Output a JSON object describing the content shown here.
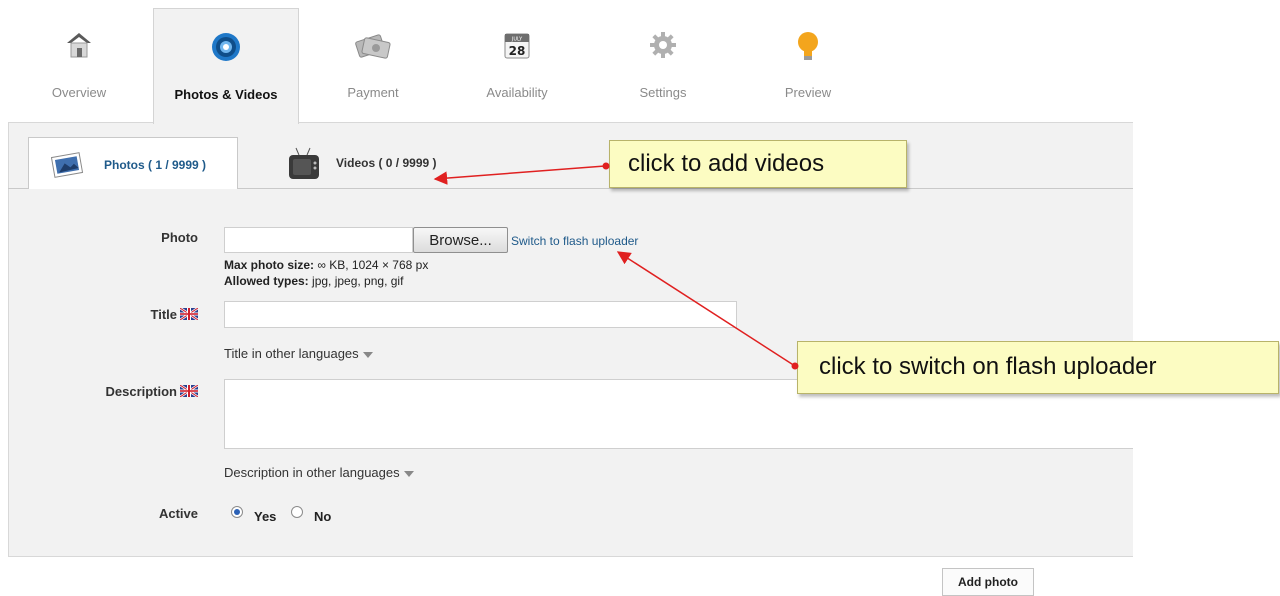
{
  "top_tabs": [
    {
      "label": "Overview",
      "icon": "house-icon",
      "active": false
    },
    {
      "label": "Photos & Videos",
      "icon": "camera-lens-icon",
      "active": true
    },
    {
      "label": "Payment",
      "icon": "payment-cards-icon",
      "active": false
    },
    {
      "label": "Availability",
      "icon": "calendar-icon",
      "active": false
    },
    {
      "label": "Settings",
      "icon": "gear-icon",
      "active": false
    },
    {
      "label": "Preview",
      "icon": "lightbulb-icon",
      "active": false
    }
  ],
  "calendar_icon_text": {
    "month": "JULY",
    "day": "28"
  },
  "sub_tabs": {
    "photos": {
      "label": "Photos ( 1 / 9999 )",
      "icon": "photo-icon"
    },
    "videos": {
      "label": "Videos ( 0 / 9999 )",
      "icon": "tv-icon"
    }
  },
  "form": {
    "photo_label": "Photo",
    "browse_label": "Browse...",
    "flash_link": "Switch to flash uploader",
    "max_size_label": "Max photo size:",
    "max_size_value": " ∞ KB, 1024 × 768 px",
    "allowed_label": "Allowed types:",
    "allowed_value": " jpg, jpeg, png, gif",
    "title_label": "Title",
    "title_value": "",
    "title_other": "Title in other languages",
    "description_label": "Description",
    "description_value": "",
    "description_other": "Description in other languages",
    "active_label": "Active",
    "yes_label": "Yes",
    "no_label": "No",
    "active_value": "Yes"
  },
  "add_photo_label": "Add photo",
  "callouts": {
    "videos": "click to add videos",
    "flash": "click to switch on flash uploader"
  },
  "colors": {
    "link": "#1f5a8a",
    "callout_bg": "#fcfcc2",
    "arrow": "#e02020",
    "panel_bg": "#f2f2f2"
  }
}
